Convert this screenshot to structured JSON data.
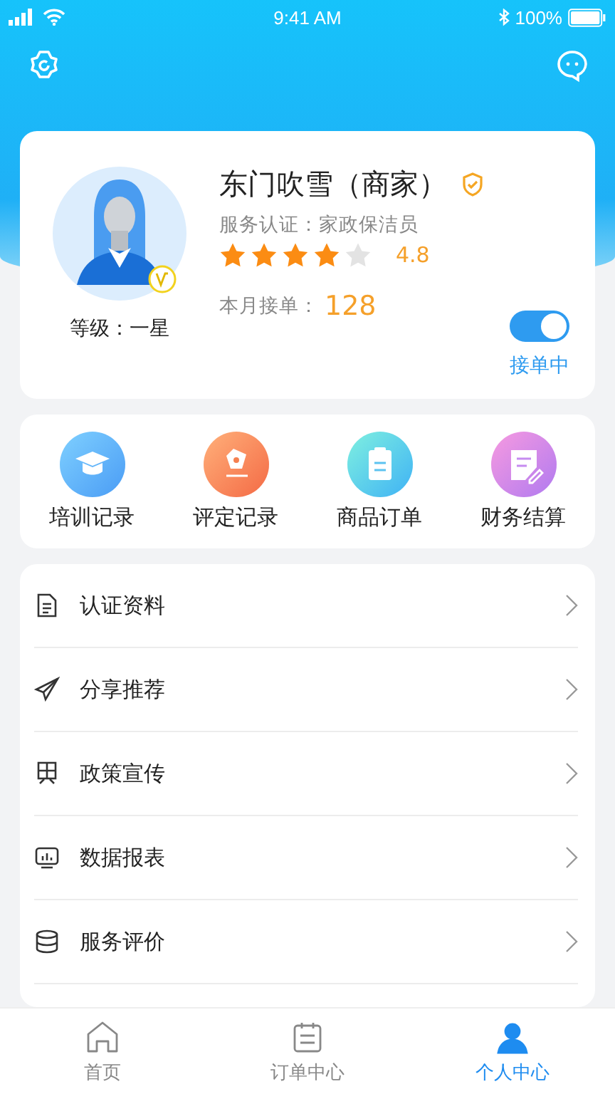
{
  "status_bar": {
    "time": "9:41 AM",
    "battery": "100%"
  },
  "profile": {
    "name": "东门吹雪（商家）",
    "certification": "服务认证：家政保洁员",
    "stars": 4,
    "rating": "4.8",
    "level": "等级：一星",
    "monthly_label": "本月接单：",
    "monthly_count": "128",
    "accepting": {
      "on": true,
      "label": "接单中"
    }
  },
  "shortcuts": [
    {
      "label": "培训记录",
      "kind": "training"
    },
    {
      "label": "评定记录",
      "kind": "review"
    },
    {
      "label": "商品订单",
      "kind": "orders"
    },
    {
      "label": "财务结算",
      "kind": "finance"
    }
  ],
  "menu": [
    {
      "label": "认证资料",
      "kind": "document"
    },
    {
      "label": "分享推荐",
      "kind": "share"
    },
    {
      "label": "政策宣传",
      "kind": "policy"
    },
    {
      "label": "数据报表",
      "kind": "report"
    },
    {
      "label": "服务评价",
      "kind": "database"
    }
  ],
  "tab_bar": [
    {
      "label": "首页",
      "kind": "home",
      "selected": false
    },
    {
      "label": "订单中心",
      "kind": "orders",
      "selected": false
    },
    {
      "label": "个人中心",
      "kind": "person",
      "selected": true
    }
  ]
}
